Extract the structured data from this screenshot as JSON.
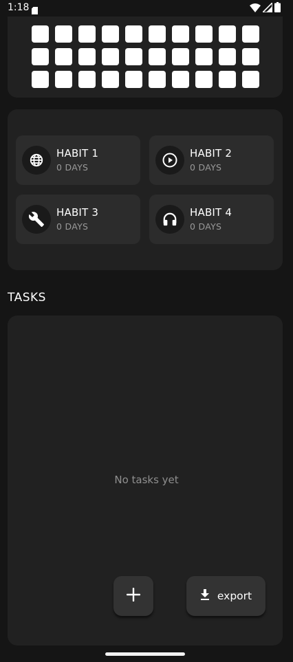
{
  "status_bar": {
    "time": "1:18",
    "icons": [
      "sd-card-icon",
      "wifi-icon",
      "cellular-signal-icon",
      "battery-icon"
    ]
  },
  "activity_grid": {
    "rows": 3,
    "columns": 10,
    "cell_color": "#ffffff"
  },
  "habits": [
    {
      "name": "HABIT 1",
      "days": "0 DAYS",
      "icon": "globe-icon"
    },
    {
      "name": "HABIT 2",
      "days": "0 DAYS",
      "icon": "play-circle-icon"
    },
    {
      "name": "HABIT 3",
      "days": "0 DAYS",
      "icon": "wrench-icon"
    },
    {
      "name": "HABIT 4",
      "days": "0 DAYS",
      "icon": "headphones-icon"
    }
  ],
  "tasks": {
    "title": "TASKS",
    "empty_message": "No tasks yet"
  },
  "actions": {
    "add_icon": "plus-icon",
    "export_icon": "download-icon",
    "export_label": "export"
  },
  "colors": {
    "background": "#151515",
    "card": "#212121",
    "habit_tile": "#2c2c2c",
    "button": "#333333",
    "secondary_text": "#9a9a9a"
  }
}
